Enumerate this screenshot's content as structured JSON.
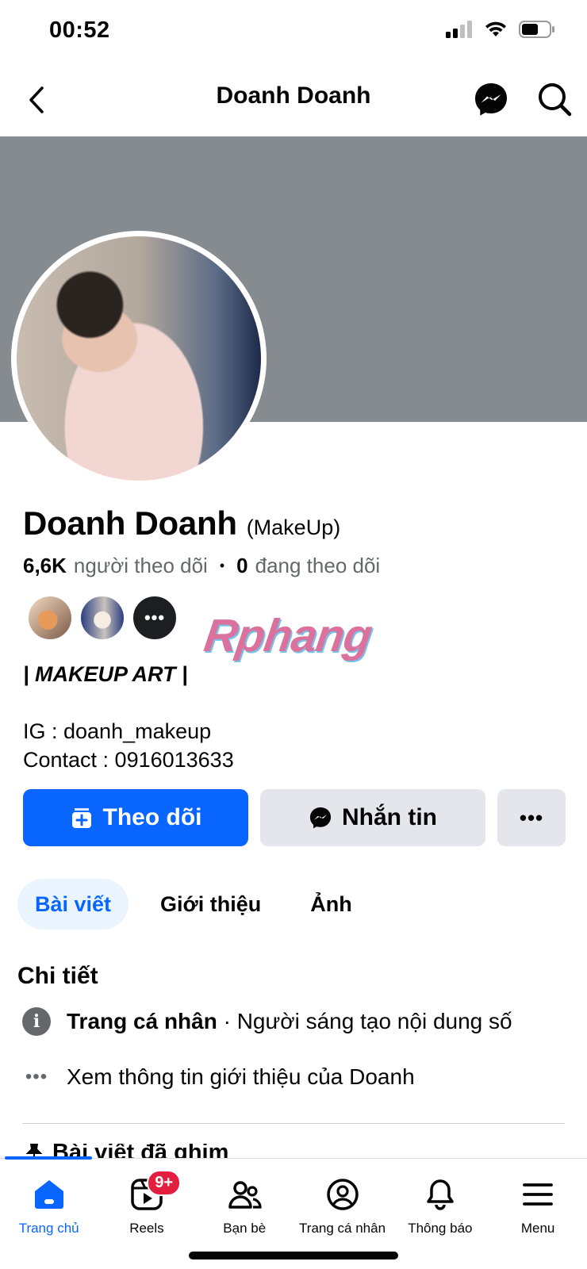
{
  "status_bar": {
    "time": "00:52"
  },
  "header": {
    "title": "Doanh Doanh"
  },
  "profile": {
    "name": "Doanh Doanh",
    "alt_name": "(MakeUp)",
    "followers_count": "6,6K",
    "followers_label": "người theo dõi",
    "following_count": "0",
    "following_label": "đang theo dõi",
    "mutual_more": "•••",
    "watermark": "Rphang",
    "bio": {
      "line1": "| MAKEUP ART |",
      "line2": "IG : doanh_makeup",
      "line3": "Contact : 0916013633"
    }
  },
  "actions": {
    "follow_label": "Theo dõi",
    "message_label": "Nhắn tin",
    "more_label": "•••"
  },
  "tabs": [
    {
      "label": "Bài viết",
      "active": true
    },
    {
      "label": "Giới thiệu",
      "active": false
    },
    {
      "label": "Ảnh",
      "active": false
    }
  ],
  "details": {
    "title": "Chi tiết",
    "row1_bold": "Trang cá nhân",
    "row1_rest": " · Người sáng tạo nội dung số",
    "row2": "Xem thông tin giới thiệu của Doanh",
    "pinned_peek": "Bài viết đã ghim"
  },
  "bottom_nav": {
    "items": [
      {
        "label": "Trang chủ",
        "icon": "home-icon"
      },
      {
        "label": "Reels",
        "icon": "reels-icon",
        "badge": "9+"
      },
      {
        "label": "Bạn bè",
        "icon": "friends-icon"
      },
      {
        "label": "Trang cá nhân",
        "icon": "profile-icon"
      },
      {
        "label": "Thông báo",
        "icon": "bell-icon"
      },
      {
        "label": "Menu",
        "icon": "menu-icon"
      }
    ]
  },
  "colors": {
    "accent": "#0866ff",
    "cover": "#868b90",
    "badge": "#e41e3f",
    "button_gray": "#e4e6eb"
  }
}
